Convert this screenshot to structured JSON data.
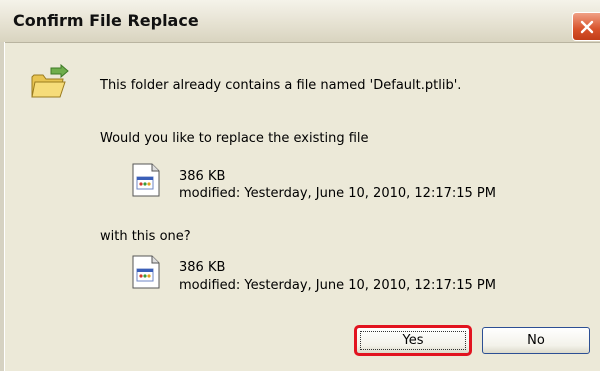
{
  "dialog": {
    "title": "Confirm File Replace",
    "message": "This folder already contains a file named 'Default.ptlib'.",
    "question": "Would you like to replace the existing file",
    "existing_file": {
      "size": "386 KB",
      "modified": "modified: Yesterday, June 10, 2010, 12:17:15 PM"
    },
    "with_label": "with this one?",
    "new_file": {
      "size": "386 KB",
      "modified": "modified: Yesterday, June 10, 2010, 12:17:15 PM"
    },
    "buttons": {
      "yes": "Yes",
      "no": "No"
    }
  },
  "icons": {
    "close": "close-icon",
    "folder": "folder-move-icon",
    "file": "ptlib-file-icon"
  },
  "colors": {
    "dialog_bg": "#ece9d8",
    "close_button": "#d8532b",
    "highlight": "#e2131f"
  }
}
